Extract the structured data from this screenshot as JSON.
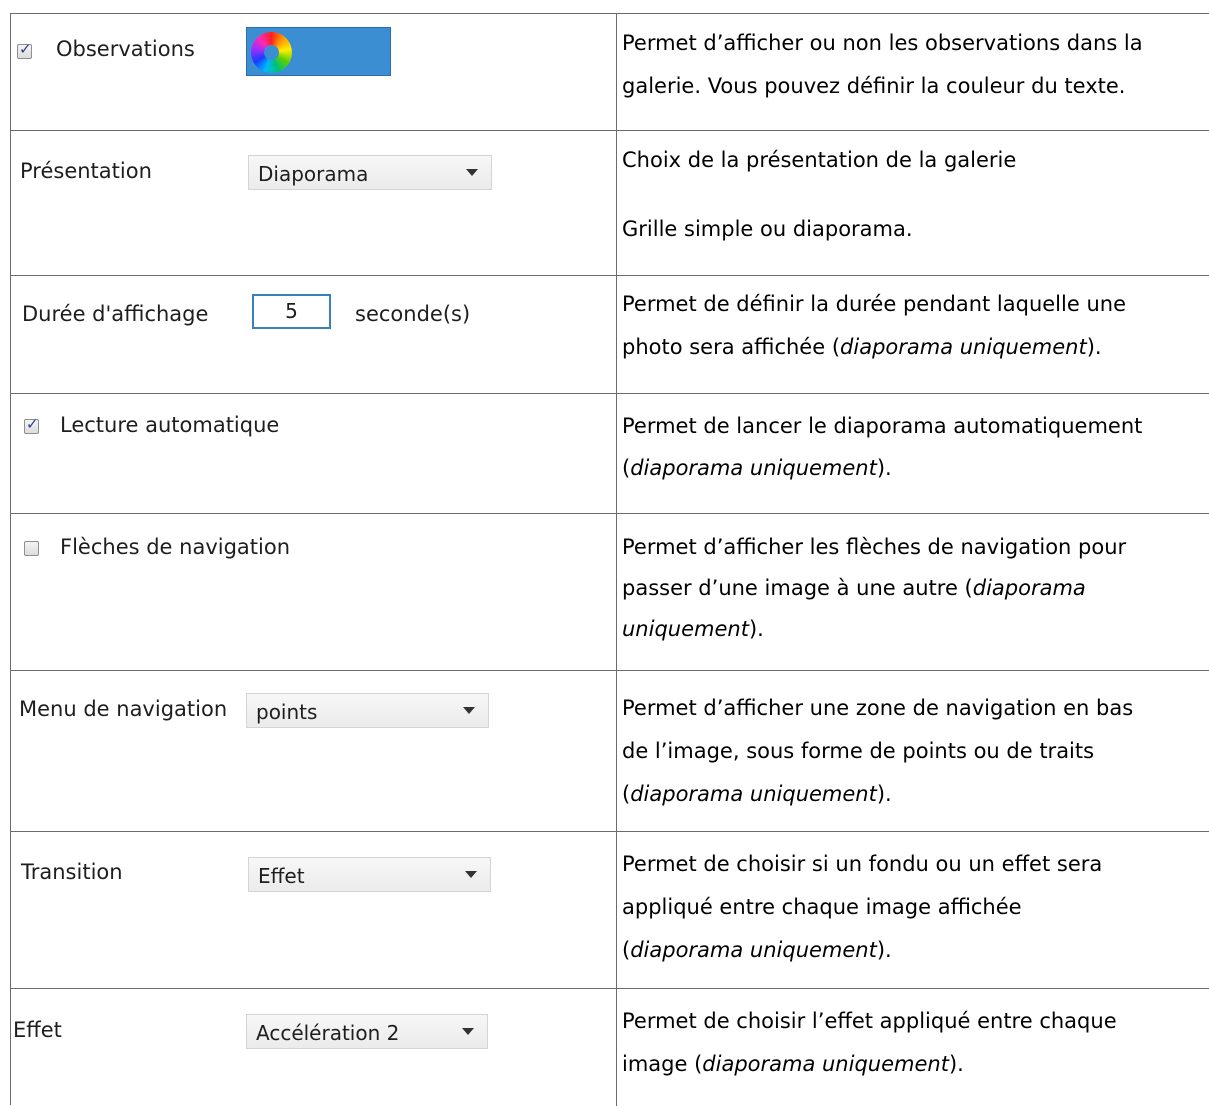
{
  "rows": [
    {
      "option": {
        "label": "Observations",
        "checked": true,
        "check_mark": "✓"
      },
      "description": {
        "line1": "Permet d’afficher ou non les observations dans la",
        "line2": "galerie. Vous pouvez définir la couleur du texte."
      }
    },
    {
      "option": {
        "label": "Présentation",
        "value": "Diaporama"
      },
      "description": {
        "line1": "Choix de la présentation de la galerie",
        "line2": "Grille simple ou diaporama."
      }
    },
    {
      "option": {
        "label": "Durée d'affichage",
        "value": "5",
        "unit": "seconde(s)"
      },
      "description": {
        "line1": "Permet de définir la durée pendant laquelle une",
        "line2_pre": "photo sera affichée (",
        "line2_em": "diaporama uniquement",
        "line2_post": ")."
      }
    },
    {
      "option": {
        "label": "Lecture automatique",
        "checked": true,
        "check_mark": "✓"
      },
      "description": {
        "line1": "Permet de lancer le diaporama automatiquement",
        "line2_pre": "(",
        "line2_em": "diaporama uniquement",
        "line2_post": ")."
      }
    },
    {
      "option": {
        "label": "Flèches de navigation",
        "checked": false
      },
      "description": {
        "line1": "Permet d’afficher les flèches de navigation pour",
        "line2_pre": "passer d’une image à une autre (",
        "line2_em": "diaporama",
        "line3_em": "uniquement",
        "line3_post": ")."
      }
    },
    {
      "option": {
        "label": "Menu de navigation",
        "value": "points"
      },
      "description": {
        "line1": "Permet d’afficher une zone de navigation en bas",
        "line2": "de l’image, sous forme de points ou de traits",
        "line3_pre": "(",
        "line3_em": "diaporama uniquement",
        "line3_post": ")."
      }
    },
    {
      "option": {
        "label": "Transition",
        "value": "Effet"
      },
      "description": {
        "line1": "Permet de choisir si un fondu ou un effet sera",
        "line2": "appliqué entre chaque image affichée",
        "line3_pre": "(",
        "line3_em": "diaporama uniquement",
        "line3_post": ")."
      }
    },
    {
      "option": {
        "label": "Effet",
        "value": "Accélération 2"
      },
      "description": {
        "line1": "Permet de choisir l’effet appliqué entre chaque",
        "line2_pre": "image (",
        "line2_em": "diaporama uniquement",
        "line2_post": ")."
      }
    }
  ],
  "colors": {
    "border": "#6b6b6b",
    "color_button": "#3c8ed3",
    "input_border": "#3b7fbf"
  }
}
